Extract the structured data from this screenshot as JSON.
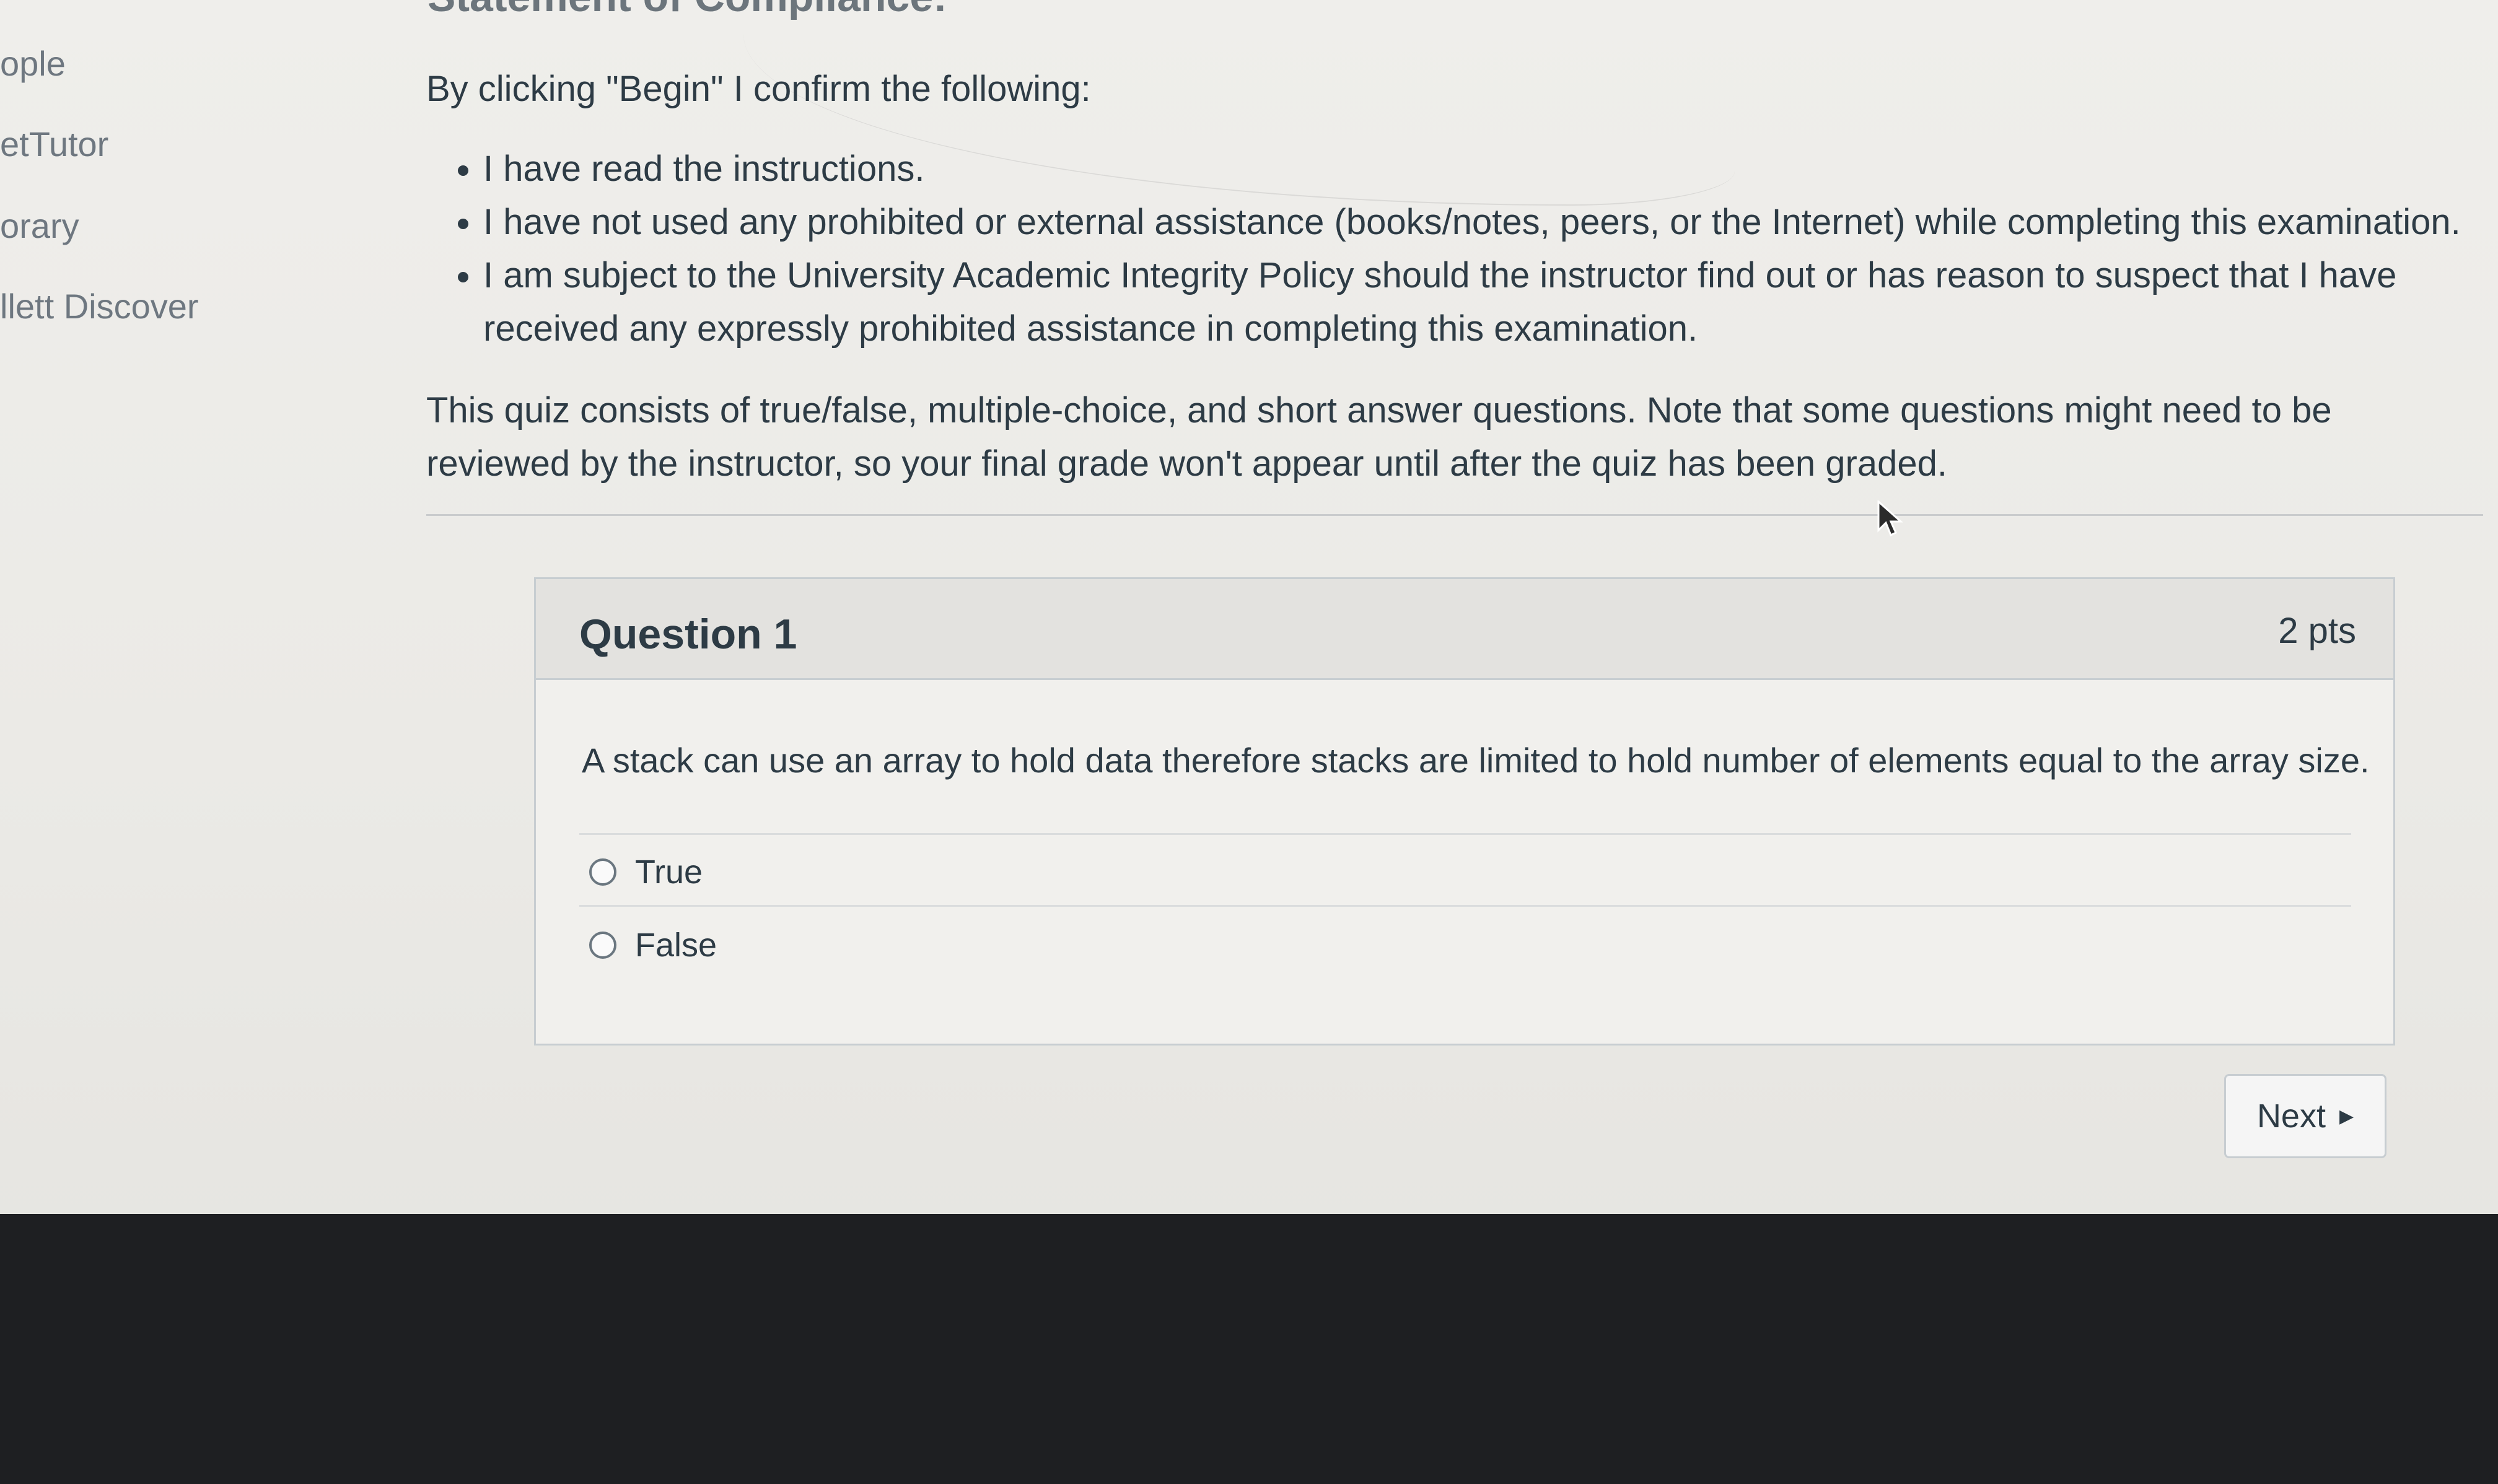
{
  "sidebar": {
    "items": [
      "ople",
      "etTutor",
      "orary",
      "llett Discover"
    ]
  },
  "page": {
    "heading": "Statement of Compliance:",
    "intro": "By clicking \"Begin\" I confirm the following:",
    "rules": [
      "I have read the instructions.",
      "I have not used any prohibited or external assistance (books/notes, peers, or the Internet) while completing this examination.",
      "I am subject to the University Academic Integrity Policy should the instructor find out or has reason to suspect that I have received any expressly prohibited assistance in completing this examination."
    ],
    "description": "This quiz consists of true/false, multiple-choice, and short answer questions. Note that some questions might need to be reviewed by the instructor, so your final grade won't appear until after the quiz has been graded."
  },
  "question": {
    "title": "Question 1",
    "points": "2 pts",
    "text": "A stack can use an array to hold data therefore stacks are limited to hold number of elements equal to the array size.",
    "answers": [
      "True",
      "False"
    ]
  },
  "navigation": {
    "next_label": "Next"
  }
}
